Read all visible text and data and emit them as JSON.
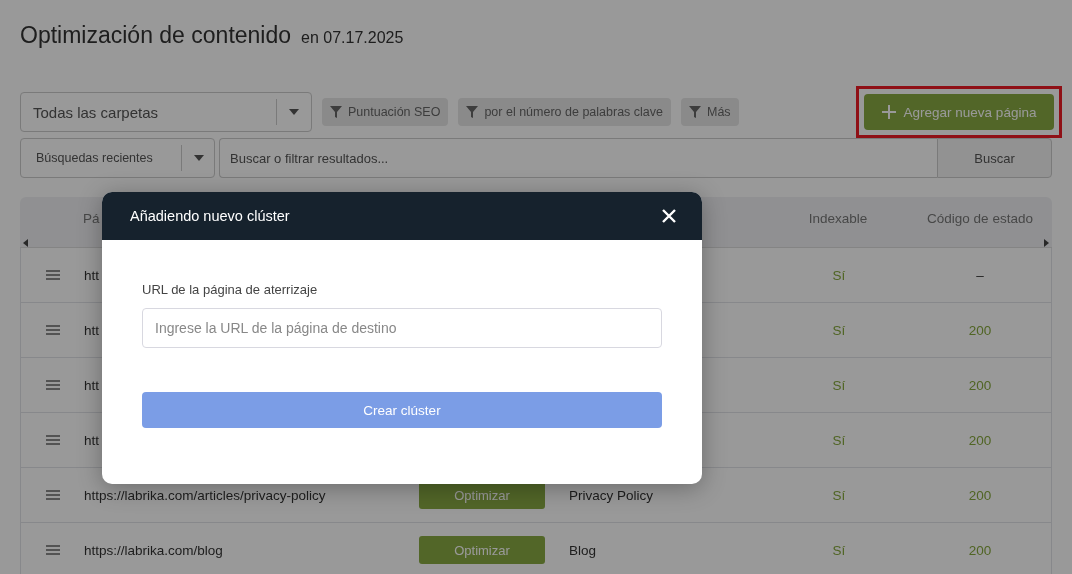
{
  "page": {
    "title": "Optimización de contenido",
    "date": "en 07.17.2025"
  },
  "toolbar": {
    "folder_select": "Todas las carpetas",
    "filters": [
      "Puntuación SEO",
      "por el número de palabras clave",
      "Más"
    ],
    "add_button": {
      "label": "Agregar nueva página",
      "highlighted": true
    }
  },
  "search": {
    "recent": "Búsquedas recientes",
    "placeholder": "Buscar o filtrar resultados...",
    "button": "Buscar"
  },
  "table": {
    "columns": [
      "Pá",
      "Indexable",
      "Código de estado"
    ],
    "rows": [
      {
        "url": "htt",
        "action": null,
        "title": null,
        "indexable": "Sí",
        "status": "–"
      },
      {
        "url": "htt",
        "action": null,
        "title": null,
        "indexable": "Sí",
        "status": "200"
      },
      {
        "url": "htt",
        "action": null,
        "title": null,
        "indexable": "Sí",
        "status": "200"
      },
      {
        "url": "htt",
        "action": null,
        "title": null,
        "indexable": "Sí",
        "status": "200"
      },
      {
        "url": "https://labrika.com/articles/privacy-policy",
        "action": "Optimizar",
        "title": "Privacy Policy",
        "indexable": "Sí",
        "status": "200"
      },
      {
        "url": "https://labrika.com/blog",
        "action": "Optimizar",
        "title": "Blog",
        "indexable": "Sí",
        "status": "200"
      }
    ]
  },
  "modal": {
    "title": "Añadiendo nuevo clúster",
    "field_label": "URL de la página de aterrizaje",
    "placeholder": "Ingrese la URL de la página de destino",
    "submit": "Crear clúster"
  }
}
